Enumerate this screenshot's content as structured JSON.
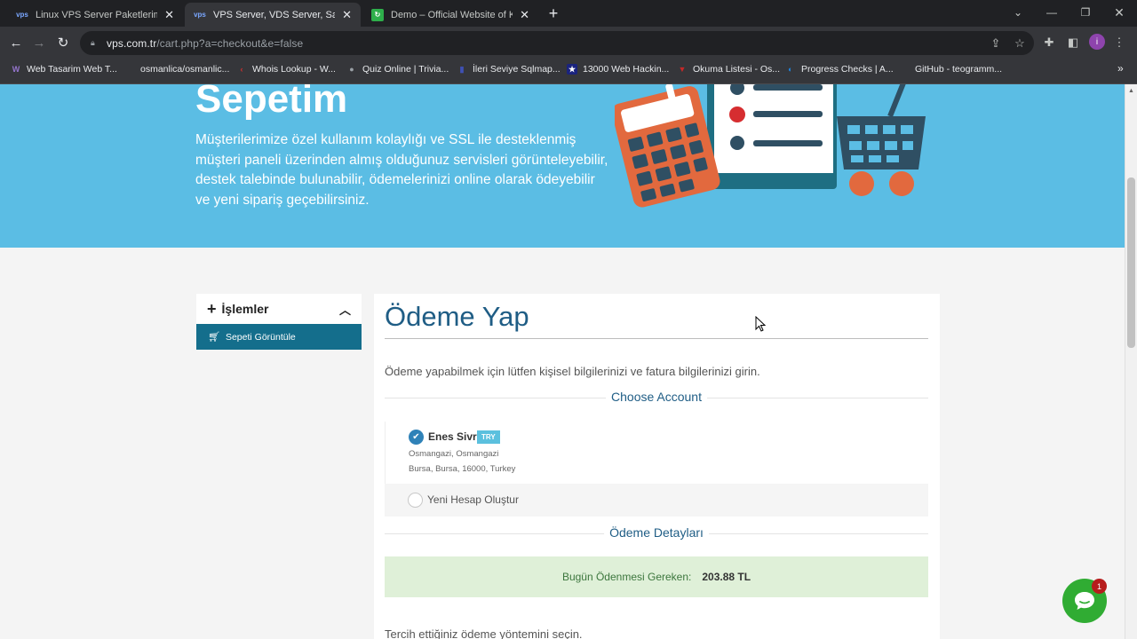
{
  "browser": {
    "tabs": [
      {
        "title": "Linux VPS Server Paketlerimizi Hemen İnceleyin",
        "favicon": "vps",
        "active": false
      },
      {
        "title": "VPS Server, VDS Server, Sanal Sunucu",
        "favicon": "vps",
        "active": true
      },
      {
        "title": "Demo – Official Website of Koha",
        "favicon": "koha",
        "active": false
      }
    ],
    "new_tab_icon": "plus-icon",
    "url_host": "vps.com.tr",
    "url_path": "/cart.php?a=checkout&e=false",
    "profile_initial": "i",
    "bookmarks": [
      {
        "label": "Web Tasarim Web T...",
        "icon": "W",
        "color": "#7b5ea7"
      },
      {
        "label": "osmanlica/osmanlic...",
        "icon": "",
        "color": "#35363a"
      },
      {
        "label": "Whois Lookup - W...",
        "icon": "‹",
        "color": "#d32f2f"
      },
      {
        "label": "Quiz Online | Trivia...",
        "icon": "●",
        "color": "#9aa0a6"
      },
      {
        "label": "İleri Seviye Sqlmap...",
        "icon": "▮",
        "color": "#3f51b5"
      },
      {
        "label": "13000 Web Hackin...",
        "icon": "★",
        "color": "#1a237e"
      },
      {
        "label": "Okuma Listesi - Os...",
        "icon": "▼",
        "color": "#c62828"
      },
      {
        "label": "Progress Checks | A...",
        "icon": "◐",
        "color": "#1e88e5"
      },
      {
        "label": "GitHub - teogramm...",
        "icon": "",
        "color": "#35363a"
      }
    ],
    "more_bookmarks": "»"
  },
  "hero": {
    "title": "Sepetim",
    "description": "Müşterilerimize özel kullanım kolaylığı ve SSL ile desteklenmiş müşteri paneli üzerinden almış olduğunuz servisleri görünteleyebilir, destek talebinde bulunabilir, ödemelerinizi online olarak ödeyebilir ve yeni sipariş geçebilirsiniz."
  },
  "sidebar": {
    "heading": "İşlemler",
    "items": [
      {
        "label": "Sepeti Görüntüle",
        "icon": "cart-icon"
      }
    ]
  },
  "checkout": {
    "title": "Ödeme Yap",
    "intro": "Ödeme yapabilmek için lütfen kişisel bilgilerinizi ve fatura bilgilerinizi girin.",
    "choose_account_label": "Choose Account",
    "account": {
      "name": "Enes Sivri",
      "currency": "TRY",
      "address_line1": "Osmangazi, Osmangazi",
      "address_line2": "Bursa, Bursa, 16000, Turkey",
      "selected": true
    },
    "new_account_label": "Yeni Hesap Oluştur",
    "payment_details_label": "Ödeme Detayları",
    "total_label": "Bugün Ödenmesi Gereken:",
    "total_value": "203.88 TL",
    "payment_method_prompt": "Tercih ettiğiniz ödeme yöntemini seçin."
  },
  "chat_widget": {
    "badge_count": "1",
    "color": "#30ac33"
  }
}
